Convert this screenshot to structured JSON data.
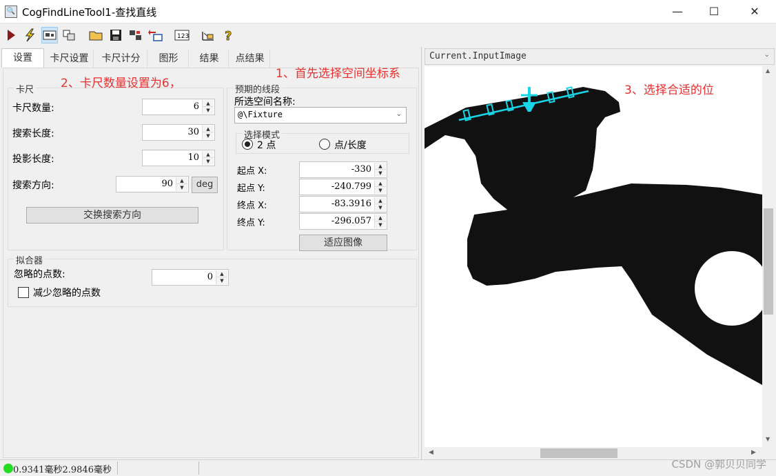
{
  "window": {
    "title": "CogFindLineTool1-查找直线",
    "minimize_glyph": "—",
    "maximize_glyph": "☐",
    "close_glyph": "✕"
  },
  "toolbar": {
    "icons": [
      "run-icon",
      "electric-run-icon",
      "display-icon",
      "window-icon",
      "open-folder-icon",
      "save-icon",
      "settings-icon",
      "reset-icon",
      "numbers-icon",
      "graphics-icon",
      "help-icon"
    ]
  },
  "tabs": [
    {
      "label": "设置"
    },
    {
      "label": "卡尺设置"
    },
    {
      "label": "卡尺计分"
    },
    {
      "label": "图形"
    },
    {
      "label": "结果"
    },
    {
      "label": "点结果"
    }
  ],
  "caliper": {
    "group_title": "卡尺",
    "num_calipers_label": "卡尺数量:",
    "num_calipers_value": "6",
    "search_length_label": "搜索长度:",
    "search_length_value": "30",
    "projection_length_label": "投影长度:",
    "projection_length_value": "10",
    "search_direction_label": "搜索方向:",
    "search_direction_value": "90",
    "unit_button": "deg",
    "swap_button": "交换搜索方向"
  },
  "expected_segment": {
    "group_title": "预期的线段",
    "space_name_label": "所选空间名称:",
    "space_name_value": "@\\Fixture",
    "mode_group_title": "选择模式",
    "mode_two_points": "2 点",
    "mode_point_length": "点/长度",
    "start_x_label": "起点 X:",
    "start_x_value": "-330",
    "start_y_label": "起点 Y:",
    "start_y_value": "-240.799",
    "end_x_label": "终点 X:",
    "end_x_value": "-83.3916",
    "end_y_label": "终点 Y:",
    "end_y_value": "-296.057",
    "fit_button": "适应图像"
  },
  "fitter": {
    "group_title": "拟合器",
    "ignore_label": "忽略的点数:",
    "ignore_value": "0",
    "decrease_label": "减少忽略的点数"
  },
  "annotations": {
    "a1": "1、首先选择空间坐标系",
    "a2": "2、卡尺数量设置为6，",
    "a3": "3、选择合适的位"
  },
  "image_panel": {
    "title": "Current.InputImage"
  },
  "status": {
    "text": "0.9341毫秒2.9846毫秒",
    "indicator_color": "#22dd22"
  },
  "watermark": "CSDN @郭贝贝同学"
}
